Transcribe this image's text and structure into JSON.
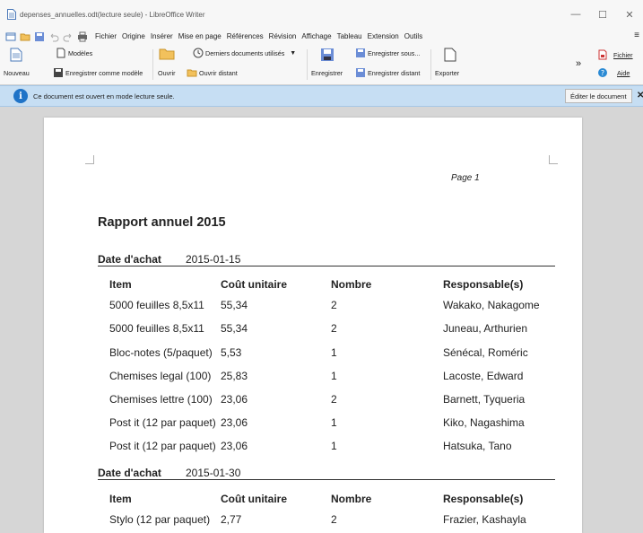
{
  "window": {
    "title": "depenses_annuelles.odt(lecture seule) - LibreOffice Writer",
    "controls": [
      "—",
      "☐",
      "✕"
    ]
  },
  "menu": {
    "items": [
      "Fichier",
      "Origine",
      "Insérer",
      "Mise en page",
      "Références",
      "Révision",
      "Affichage",
      "Tableau",
      "Extension",
      "Outils"
    ],
    "side": "≡"
  },
  "toolbar": {
    "nouveau": "Nouveau",
    "modeles": "Modèles",
    "enregistrer_modele": "Enregistrer comme modèle",
    "ouvrir": "Ouvrir",
    "derniers": "Derniers documents utilisés",
    "ouvrir_distant": "Ouvrir distant",
    "enregistrer": "Enregistrer",
    "enregistrer_sous": "Enregistrer sous...",
    "enregistrer_distant": "Enregistrer distant",
    "exporter": "Exporter",
    "more": "»",
    "fichier": "Fichier",
    "aide": "Aide"
  },
  "infobar": {
    "icon": "i",
    "message": "Ce document est ouvert en mode lecture seule.",
    "edit_button": "Éditer le document",
    "close": "✕"
  },
  "document": {
    "page_label": "Page 1",
    "title": "Rapport annuel 2015",
    "headers": {
      "item": "Item",
      "cout": "Coût unitaire",
      "nombre": "Nombre",
      "resp": "Responsable(s)"
    },
    "groups": [
      {
        "date_label": "Date d'achat",
        "date": "2015-01-15",
        "rows": [
          {
            "item": "5000 feuilles 8,5x11",
            "cout": "55,34",
            "nombre": "2",
            "resp": "Wakako, Nakagome"
          },
          {
            "item": "5000 feuilles 8,5x11",
            "cout": "55,34",
            "nombre": "2",
            "resp": "Juneau, Arthurien"
          },
          {
            "item": "Bloc-notes (5/paquet)",
            "cout": "5,53",
            "nombre": "1",
            "resp": "Sénécal, Roméric"
          },
          {
            "item": "Chemises legal (100)",
            "cout": "25,83",
            "nombre": "1",
            "resp": "Lacoste, Edward"
          },
          {
            "item": "Chemises lettre (100)",
            "cout": "23,06",
            "nombre": "2",
            "resp": "Barnett, Tyqueria"
          },
          {
            "item": "Post it (12 par paquet)",
            "cout": "23,06",
            "nombre": "1",
            "resp": "Kiko, Nagashima"
          },
          {
            "item": "Post it (12 par paquet)",
            "cout": "23,06",
            "nombre": "1",
            "resp": "Hatsuka, Tano"
          }
        ]
      },
      {
        "date_label": "Date d'achat",
        "date": "2015-01-30",
        "rows": [
          {
            "item": "Stylo (12 par paquet)",
            "cout": "2,77",
            "nombre": "2",
            "resp": "Frazier, Kashayla"
          }
        ]
      }
    ]
  }
}
